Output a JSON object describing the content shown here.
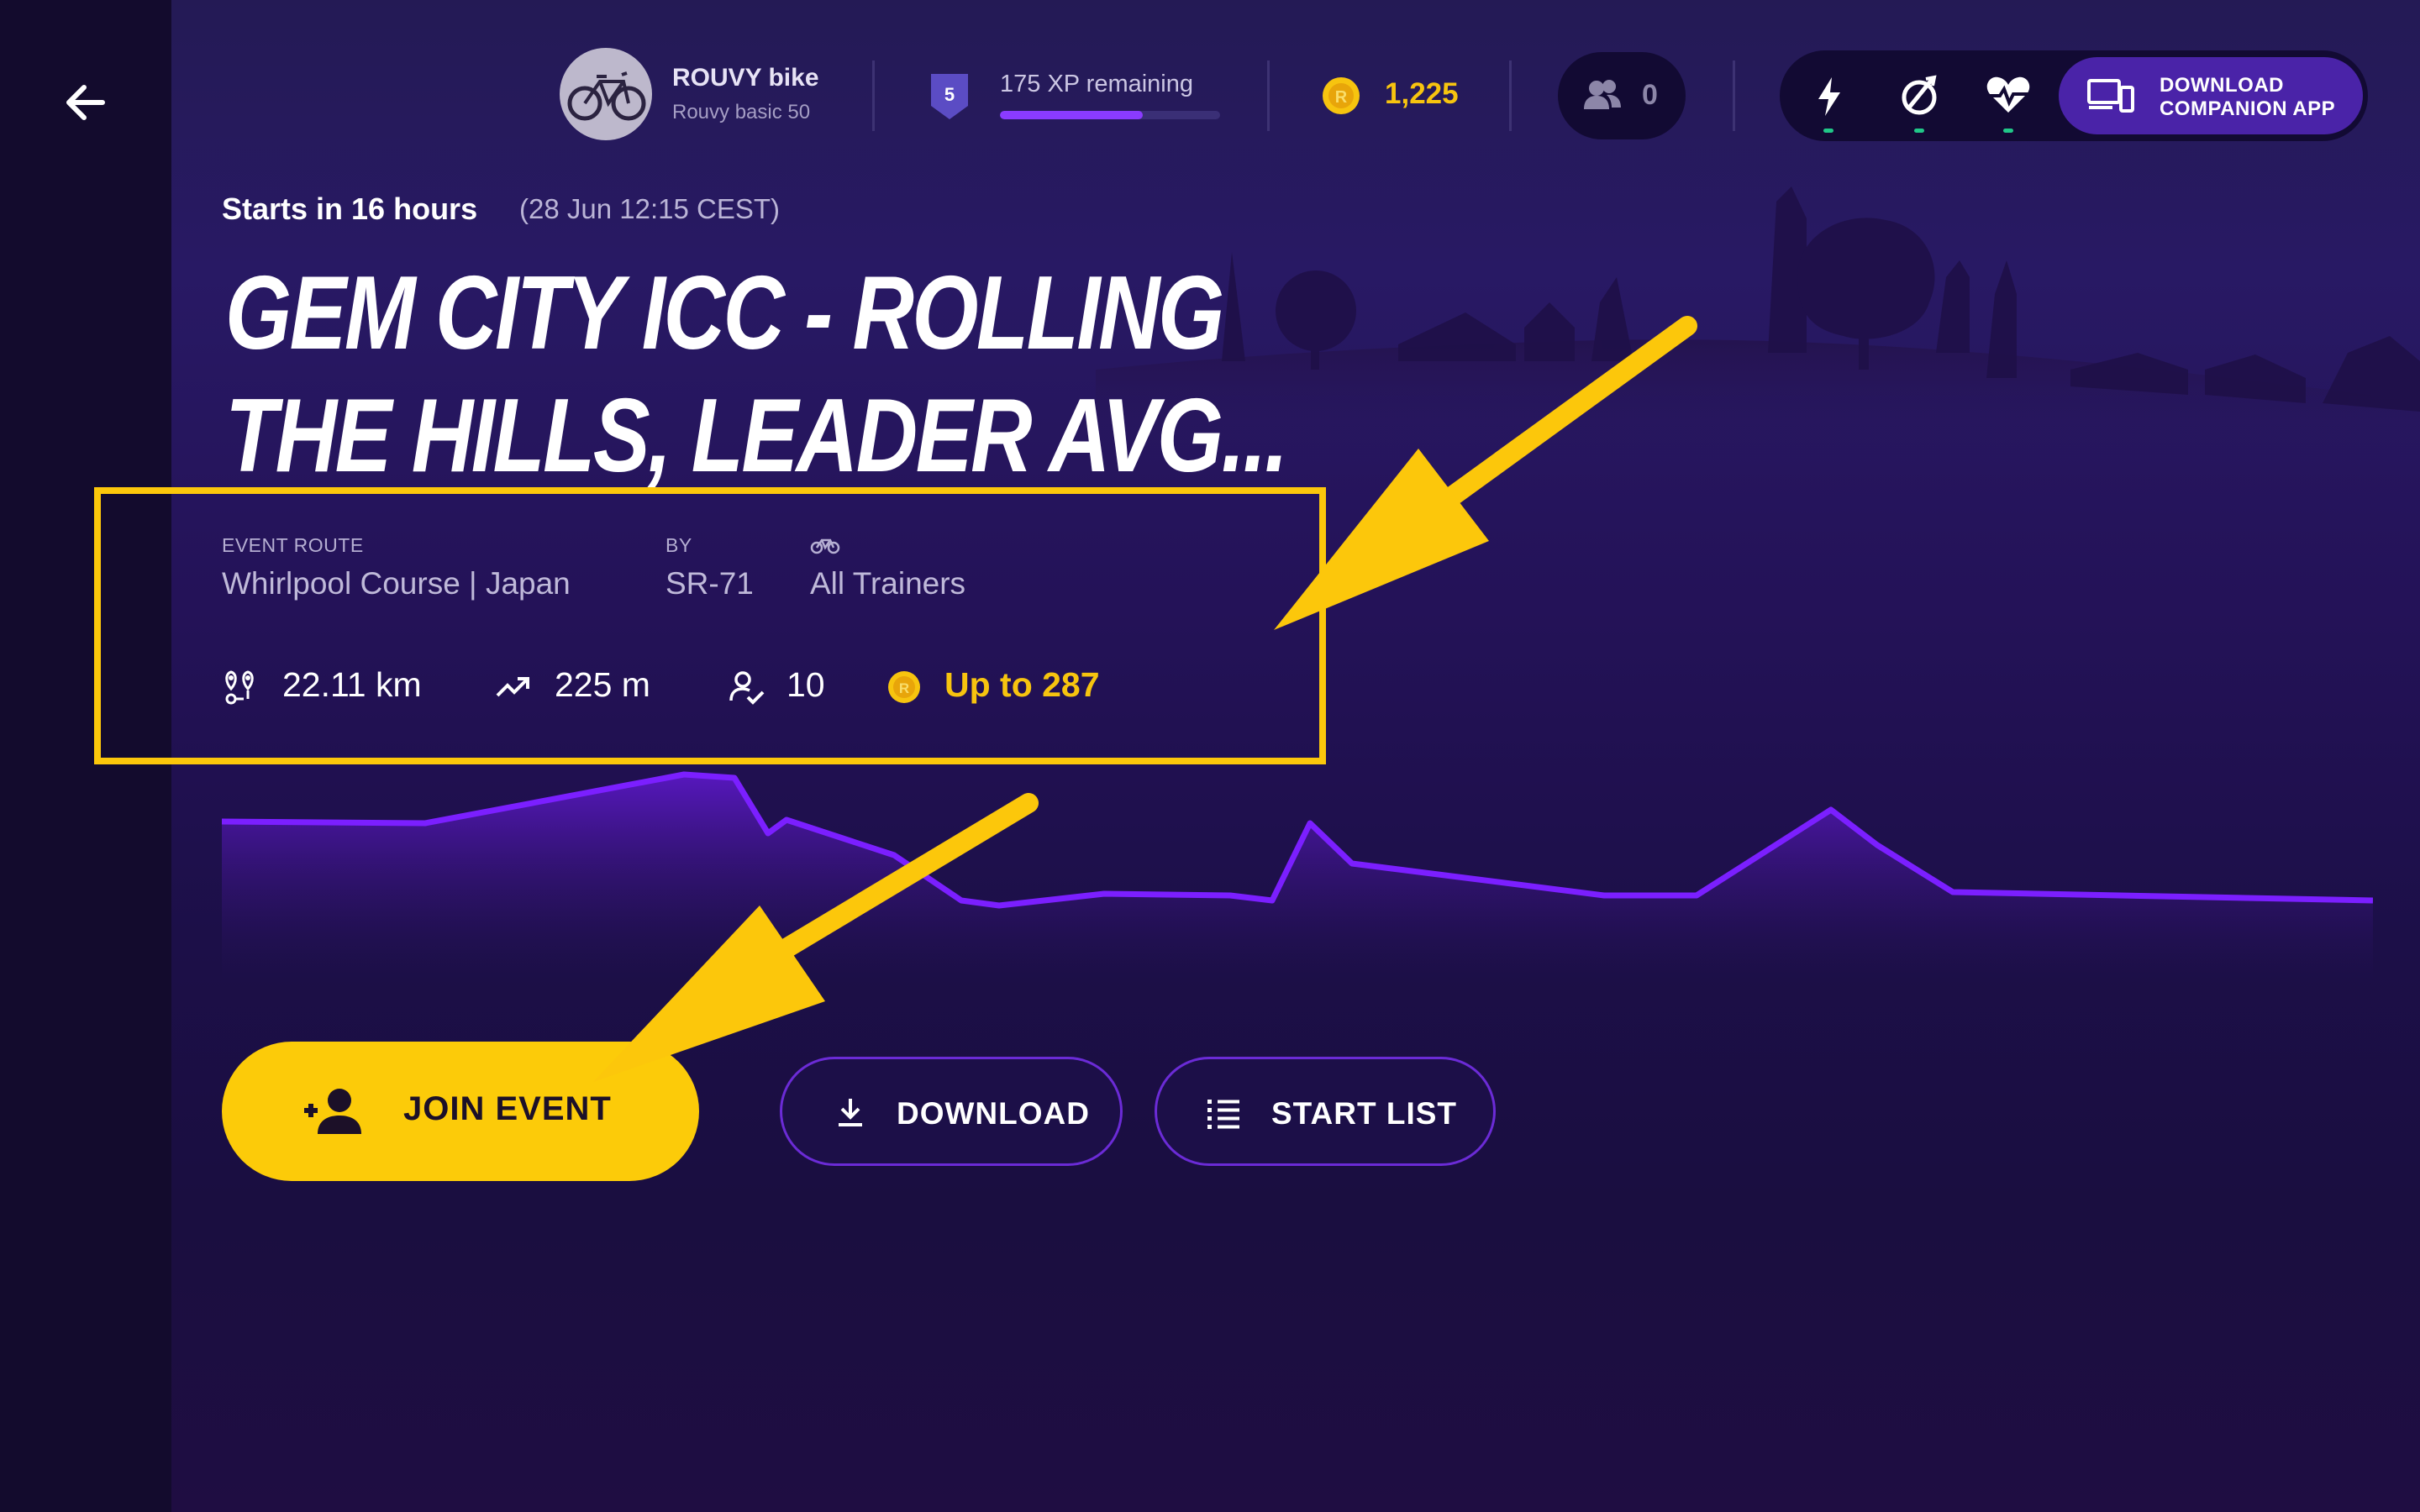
{
  "top_bar": {
    "bike_name": "ROUVY bike",
    "bike_model": "Rouvy basic 50",
    "level": "5",
    "xp_text": "175 XP remaining",
    "xp_progress_percent": 65,
    "coin_balance": "1,225",
    "friends_count": "0",
    "companion_button_label": "DOWNLOAD COMPANION APP",
    "sensor_icons": [
      "power-icon",
      "cadence-icon",
      "heart-rate-icon"
    ],
    "sensor_status_color": "#21c788"
  },
  "event": {
    "starts_in": "Starts in 16 hours",
    "start_date": "(28 Jun 12:15 CEST)",
    "title_line_1": "GEM CITY ICC - ROLLING",
    "title_line_2": "THE HILLS, LEADER AVG...",
    "route_label": "EVENT ROUTE",
    "route_value": "Whirlpool Course | Japan",
    "by_label": "BY",
    "by_value": "SR-71",
    "trainer_value": "All Trainers",
    "distance": "22.11 km",
    "elevation_gain": "225 m",
    "participants": "10",
    "reward": "Up to 287"
  },
  "actions": {
    "join_label": "JOIN EVENT",
    "download_label": "DOWNLOAD",
    "start_list_label": "START LIST"
  },
  "colors": {
    "accent_yellow": "#fccb09",
    "coin_gold": "#f7c40f",
    "profile_purple": "#7b1fff",
    "button_border": "#6b2bd6",
    "annotation_yellow": "#fcc70b"
  }
}
